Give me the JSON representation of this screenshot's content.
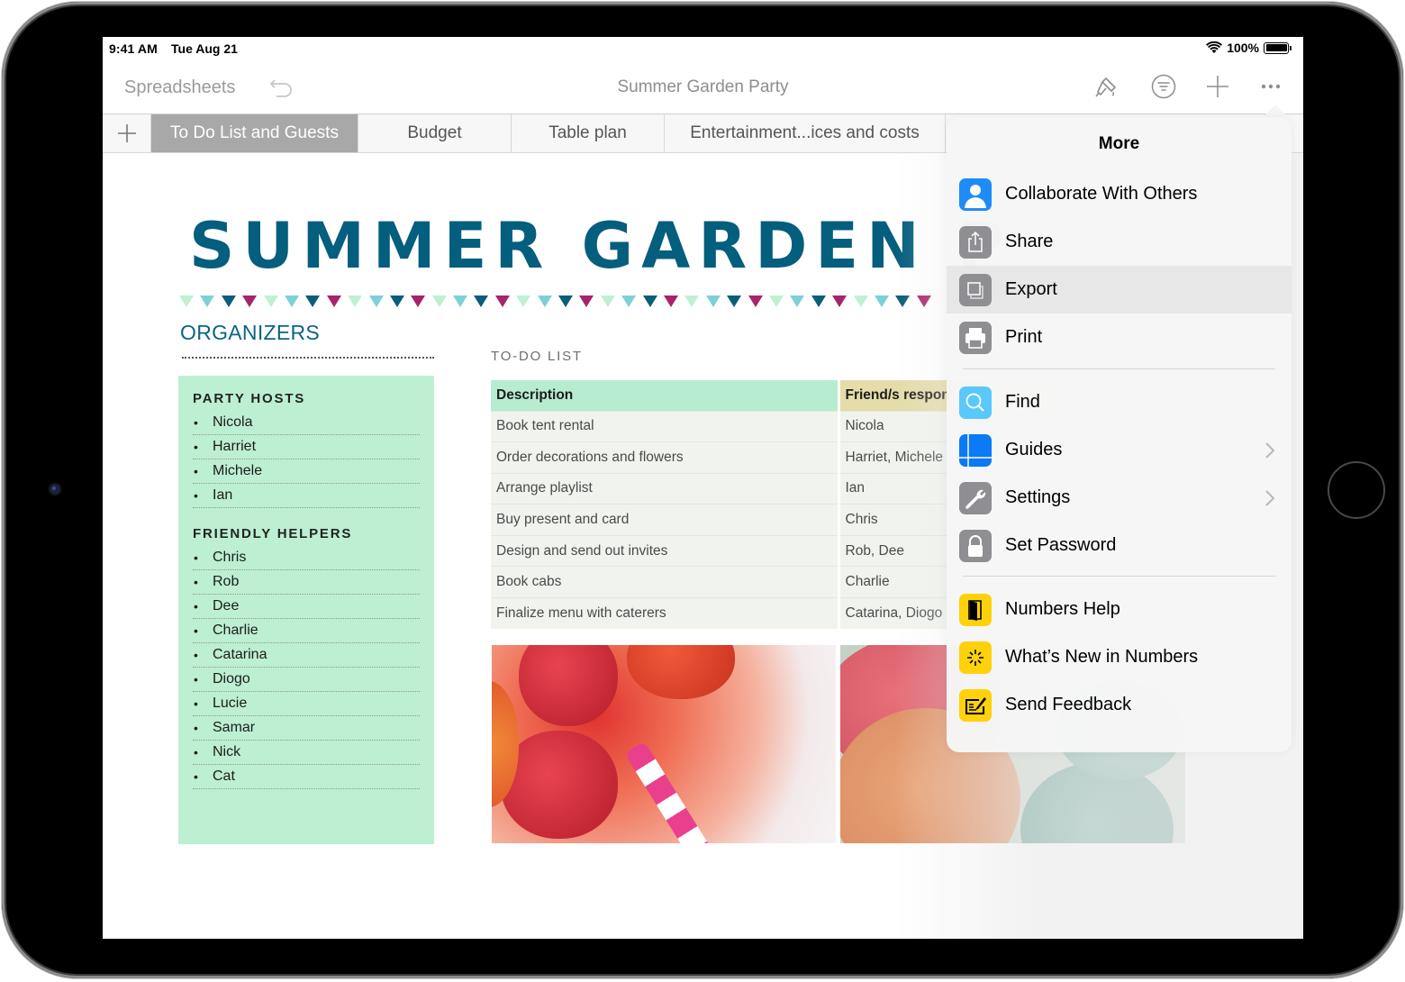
{
  "status_bar": {
    "time": "9:41 AM",
    "date": "Tue Aug 21",
    "battery": "100%",
    "battery_level_percent": 100
  },
  "toolbar": {
    "back_label": "Spreadsheets",
    "title": "Summer Garden Party",
    "icons": [
      "undo-icon",
      "paintbrush-icon",
      "filter-icon",
      "plus-icon",
      "more-icon"
    ]
  },
  "tabs": [
    {
      "label": "To Do List and Guests",
      "active": true
    },
    {
      "label": "Budget",
      "active": false
    },
    {
      "label": "Table plan",
      "active": false
    },
    {
      "label": "Entertainment...ices and costs",
      "active": false
    }
  ],
  "sheet": {
    "title": "SUMMER GARDEN P",
    "bunting_colors": [
      "#bff0d4",
      "#7fcfd8",
      "#0a5e7a",
      "#a7236a"
    ],
    "organizers": {
      "heading": "ORGANIZERS",
      "party_hosts_heading": "PARTY HOSTS",
      "party_hosts": [
        "Nicola",
        "Harriet",
        "Michele",
        "Ian"
      ],
      "friendly_helpers_heading": "FRIENDLY HELPERS",
      "friendly_helpers": [
        "Chris",
        "Rob",
        "Dee",
        "Charlie",
        "Catarina",
        "Diogo",
        "Lucie",
        "Samar",
        "Nick",
        "Cat"
      ]
    },
    "todo": {
      "label": "TO-DO LIST",
      "columns": [
        "Description",
        "Friend/s respon"
      ],
      "rows": [
        [
          "Book tent rental",
          "Nicola"
        ],
        [
          "Order decorations and flowers",
          "Harriet, Michele"
        ],
        [
          "Arrange playlist",
          "Ian"
        ],
        [
          "Buy present and card",
          "Chris"
        ],
        [
          "Design and send out invites",
          "Rob, Dee"
        ],
        [
          "Book cabs",
          "Charlie"
        ],
        [
          "Finalize menu with caterers",
          "Catarina, Diogo"
        ]
      ]
    }
  },
  "more_menu": {
    "title": "More",
    "items": [
      {
        "label": "Collaborate With Others",
        "icon": "collaborate-icon",
        "chevron": false
      },
      {
        "label": "Share",
        "icon": "share-icon",
        "chevron": false
      },
      {
        "label": "Export",
        "icon": "export-icon",
        "chevron": false,
        "highlighted": true
      },
      {
        "label": "Print",
        "icon": "print-icon",
        "chevron": false
      },
      {
        "label": "Find",
        "icon": "find-icon",
        "chevron": false
      },
      {
        "label": "Guides",
        "icon": "guides-icon",
        "chevron": true
      },
      {
        "label": "Settings",
        "icon": "settings-icon",
        "chevron": true
      },
      {
        "label": "Set Password",
        "icon": "lock-icon",
        "chevron": false
      },
      {
        "label": "Numbers Help",
        "icon": "help-book-icon",
        "chevron": false
      },
      {
        "label": "What’s New in Numbers",
        "icon": "whats-new-icon",
        "chevron": false
      },
      {
        "label": "Send Feedback",
        "icon": "feedback-icon",
        "chevron": false
      }
    ]
  }
}
